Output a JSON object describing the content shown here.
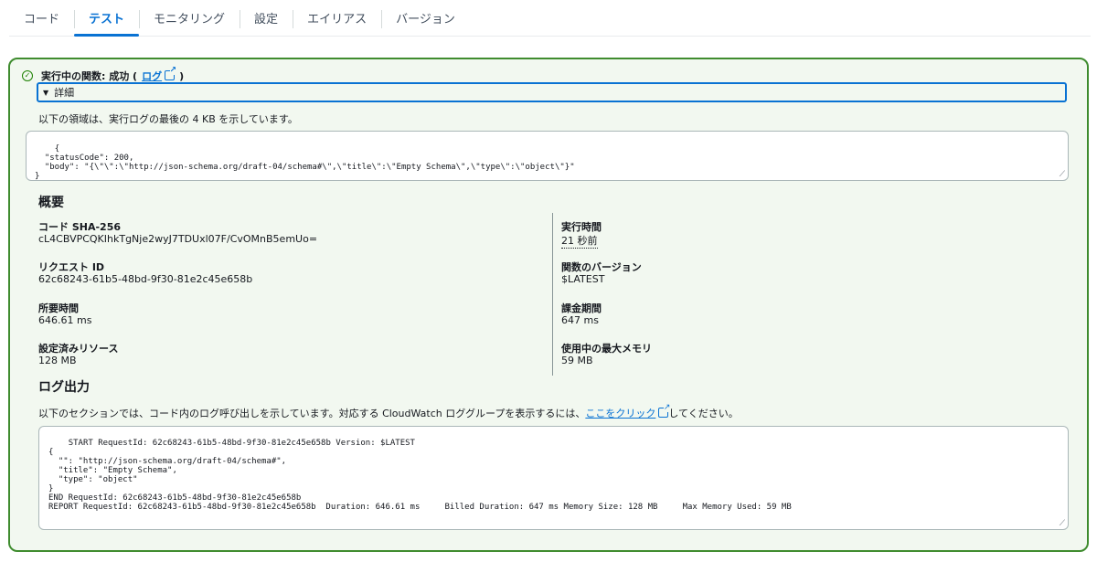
{
  "tabs": [
    {
      "label": "コード"
    },
    {
      "label": "テスト"
    },
    {
      "label": "モニタリング"
    },
    {
      "label": "設定"
    },
    {
      "label": "エイリアス"
    },
    {
      "label": "バージョン"
    }
  ],
  "status": {
    "prefix": "実行中の関数: 成功 (",
    "link": "ログ",
    "suffix": ")"
  },
  "details_label": "詳細",
  "result_desc": "以下の領域は、実行ログの最後の 4 KB を示しています。",
  "result_code": "{\n  \"statusCode\": 200,\n  \"body\": \"{\\\"\\\":\\\"http://json-schema.org/draft-04/schema#\\\",\\\"title\\\":\\\"Empty Schema\\\",\\\"type\\\":\\\"object\\\"}\"\n}",
  "summary": {
    "heading": "概要",
    "left": [
      {
        "label": "コード SHA-256",
        "value": "cL4CBVPCQKIhkTgNje2wyJ7TDUxl07F/CvOMnB5emUo="
      },
      {
        "label": "リクエスト ID",
        "value": "62c68243-61b5-48bd-9f30-81e2c45e658b"
      },
      {
        "label": "所要時間",
        "value": "646.61 ms"
      },
      {
        "label": "設定済みリソース",
        "value": "128 MB"
      }
    ],
    "right": [
      {
        "label": "実行時間",
        "value": "21 秒前"
      },
      {
        "label": "関数のバージョン",
        "value": "$LATEST"
      },
      {
        "label": "課金期間",
        "value": "647 ms"
      },
      {
        "label": "使用中の最大メモリ",
        "value": "59 MB"
      }
    ]
  },
  "log": {
    "heading": "ログ出力",
    "desc_prefix": "以下のセクションでは、コード内のログ呼び出しを示しています。対応する CloudWatch ロググループを表示するには、",
    "desc_link": "ここをクリック",
    "desc_suffix": "してください。",
    "code": "START RequestId: 62c68243-61b5-48bd-9f30-81e2c45e658b Version: $LATEST\n{\n  \"\": \"http://json-schema.org/draft-04/schema#\",\n  \"title\": \"Empty Schema\",\n  \"type\": \"object\"\n}\nEND RequestId: 62c68243-61b5-48bd-9f30-81e2c45e658b\nREPORT RequestId: 62c68243-61b5-48bd-9f30-81e2c45e658b  Duration: 646.61 ms     Billed Duration: 647 ms Memory Size: 128 MB     Max Memory Used: 59 MB"
  },
  "colors": {
    "accent": "#0972d3",
    "success_border": "#3f8c2f",
    "success_bg": "#f2f8f0"
  }
}
